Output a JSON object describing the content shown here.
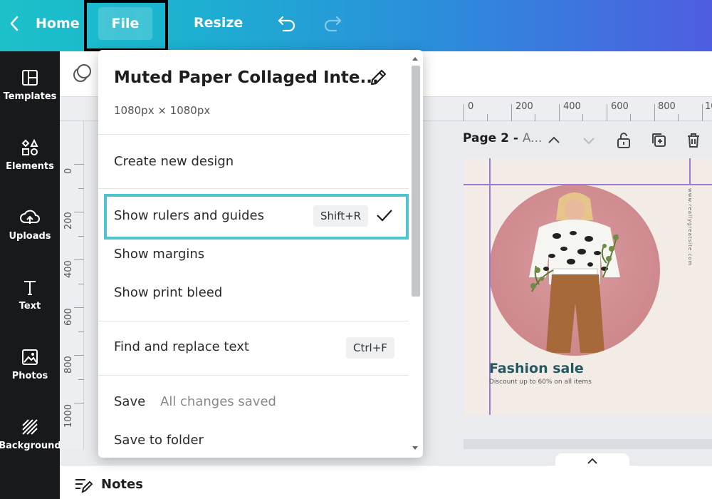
{
  "topbar": {
    "home_label": "Home",
    "file_label": "File",
    "resize_label": "Resize",
    "undo_icon": "undo-icon",
    "redo_icon": "redo-icon"
  },
  "sidebar": {
    "items": [
      {
        "label": "Templates",
        "icon": "templates-icon"
      },
      {
        "label": "Elements",
        "icon": "elements-icon"
      },
      {
        "label": "Uploads",
        "icon": "uploads-icon"
      },
      {
        "label": "Text",
        "icon": "text-icon"
      },
      {
        "label": "Photos",
        "icon": "photos-icon"
      },
      {
        "label": "Background",
        "icon": "background-icon"
      }
    ]
  },
  "ruler": {
    "top_labels": [
      "0",
      "200",
      "400",
      "600",
      "800",
      "10"
    ],
    "left_labels": [
      "0",
      "200",
      "400",
      "600",
      "800",
      "1000"
    ]
  },
  "page": {
    "title_bold": "Page 2 - ",
    "title_rest": "A..."
  },
  "design": {
    "headline": "Fashion sale",
    "subline": "Discount up to 60% on all items",
    "url": "www.reallygreatsite.com"
  },
  "menu": {
    "design_name": "Muted Paper Collaged Inte...",
    "design_size": "1080px × 1080px",
    "create_new": "Create new design",
    "show_rulers": "Show rulers and guides",
    "show_rulers_shortcut": "Shift+R",
    "show_margins": "Show margins",
    "show_print_bleed": "Show print bleed",
    "find_replace": "Find and replace text",
    "find_replace_shortcut": "Ctrl+F",
    "save": "Save",
    "save_status": "All changes saved",
    "save_to_folder": "Save to folder"
  },
  "notes": {
    "label": "Notes"
  },
  "colors": {
    "accent_teal": "#4dc5cc",
    "guide_purple": "#9b7bd4",
    "headline_teal": "#245862"
  }
}
